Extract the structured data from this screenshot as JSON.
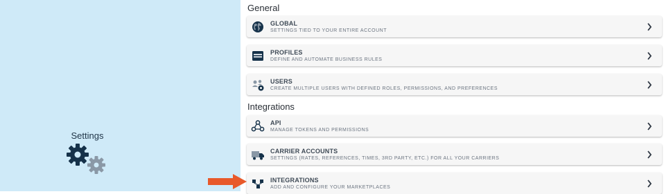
{
  "left_panel": {
    "title": "Settings",
    "icon": "gears-icon"
  },
  "sections": [
    {
      "heading": "General",
      "items": [
        {
          "title": "GLOBAL",
          "subtitle": "SETTINGS TIED TO YOUR ENTIRE ACCOUNT",
          "icon": "globe-icon"
        },
        {
          "title": "PROFILES",
          "subtitle": "DEFINE AND AUTOMATE BUSINESS RULES",
          "icon": "window-icon"
        },
        {
          "title": "USERS",
          "subtitle": "CREATE MULTIPLE USERS WITH DEFINED ROLES, PERMISSIONS, AND PREFERENCES",
          "icon": "users-gear-icon"
        }
      ]
    },
    {
      "heading": "Integrations",
      "items": [
        {
          "title": "API",
          "subtitle": "MANAGE TOKENS AND PERMISSIONS",
          "icon": "api-icon"
        },
        {
          "title": "CARRIER ACCOUNTS",
          "subtitle": "SETTINGS (RATES, REFERENCES, TIMES, 3RD PARTY, ETC.) FOR ALL YOUR CARRIERS",
          "icon": "truck-icon"
        },
        {
          "title": "INTEGRATIONS",
          "subtitle": "ADD AND CONFIGURE YOUR MARKETPLACES",
          "icon": "integrations-icon"
        }
      ]
    }
  ],
  "annotation": {
    "icon": "arrow-right-icon",
    "color": "#e8592a"
  },
  "colors": {
    "left_panel_bg": "#cfeaf8",
    "icon_dark": "#16324a",
    "icon_gray": "#8a98a6",
    "chevron": "#2b3440"
  }
}
